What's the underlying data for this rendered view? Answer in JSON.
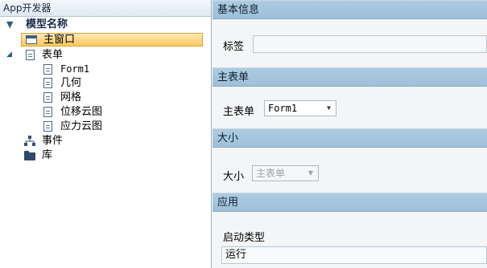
{
  "left_panel": {
    "title": "App开发器",
    "tree": {
      "root": "模型名称",
      "main_window": "主窗口",
      "forms": "表单",
      "form_items": [
        "Form1",
        "几何",
        "网格",
        "位移云图",
        "应力云图"
      ],
      "events": "事件",
      "library": "库"
    }
  },
  "right_panel": {
    "basic_info": {
      "header": "基本信息",
      "label_field": "标签",
      "label_value": ""
    },
    "main_form": {
      "header": "主表单",
      "field_label": "主表单",
      "selected": "Form1"
    },
    "size": {
      "header": "大小",
      "field_label": "大小",
      "selected": "主表单"
    },
    "application": {
      "header": "应用",
      "startup_label": "启动类型",
      "startup_value": "运行"
    }
  }
}
